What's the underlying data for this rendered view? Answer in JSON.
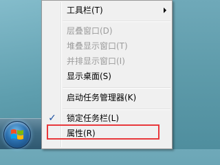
{
  "context_menu": {
    "items": [
      {
        "label": "工具栏(T)",
        "disabled": false,
        "submenu": true
      },
      {
        "label": "层叠窗口(D)",
        "disabled": true
      },
      {
        "label": "堆叠显示窗口(T)",
        "disabled": true
      },
      {
        "label": "并排显示窗口(I)",
        "disabled": true
      },
      {
        "label": "显示桌面(S)",
        "disabled": false
      },
      {
        "label": "启动任务管理器(K)",
        "disabled": false
      },
      {
        "label": "锁定任务栏(L)",
        "disabled": false,
        "checked": true
      },
      {
        "label": "属性(R)",
        "disabled": false,
        "highlighted": true
      }
    ]
  },
  "highlight_color": "#e8373a",
  "taskbar": {
    "start_button_icon": "windows-logo-icon"
  }
}
